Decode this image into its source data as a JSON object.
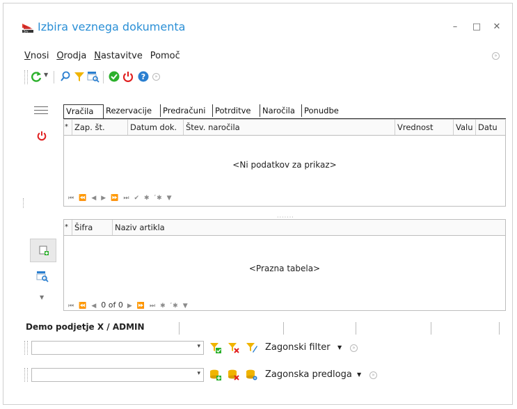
{
  "window": {
    "title": "Izbira veznega dokumenta",
    "minimize_glyph": "–",
    "maximize_glyph": "□",
    "close_glyph": "✕"
  },
  "menu": {
    "items": [
      {
        "first": "V",
        "rest": "nosi"
      },
      {
        "first": "O",
        "rest": "rodja"
      },
      {
        "first": "N",
        "rest": "astavitve"
      },
      {
        "first": "",
        "rest": "Pomoč"
      }
    ]
  },
  "toolbar": {
    "icons": [
      "refresh-icon",
      "search-icon",
      "filter-icon",
      "table-search-icon",
      "confirm-icon",
      "power-icon",
      "help-icon"
    ]
  },
  "tabs": [
    "Vračila",
    "Rezervacije",
    "Predračuni",
    "Potrditve",
    "Naročila",
    "Ponudbe"
  ],
  "upper_grid": {
    "columns": [
      "*",
      "Zap. št.",
      "Datum dok.",
      "Štev. naročila",
      "Vrednost",
      "Valu",
      "Datu"
    ],
    "empty_text": "<Ni podatkov za prikaz>",
    "nav": [
      "⏮",
      "⏪",
      "◀",
      "▶",
      "⏩",
      "⏭",
      "✔",
      "✱",
      "ʹ✱",
      "▼"
    ]
  },
  "lower_grid": {
    "columns": [
      "*",
      "Šifra",
      "Naziv artikla"
    ],
    "empty_text": "<Prazna tabela>",
    "nav_left": [
      "⏮",
      "⏪",
      "◀"
    ],
    "record_count": "0 of 0",
    "nav_right": [
      "▶",
      "⏩",
      "⏭",
      "✱",
      "ʹ✱",
      "▼"
    ]
  },
  "status": {
    "company_user": "Demo podjetje X / ADMIN"
  },
  "filter_row": {
    "value": "",
    "label": "Zagonski filter",
    "dropdown_glyph": "▾"
  },
  "template_row": {
    "value": "",
    "label": "Zagonska predloga",
    "dropdown_glyph": "▾"
  },
  "colors": {
    "title": "#2a8fd6",
    "accent_red": "#e02020",
    "accent_green": "#2bb02b",
    "accent_blue": "#2a7fd0",
    "filter_yellow": "#f0b400"
  }
}
